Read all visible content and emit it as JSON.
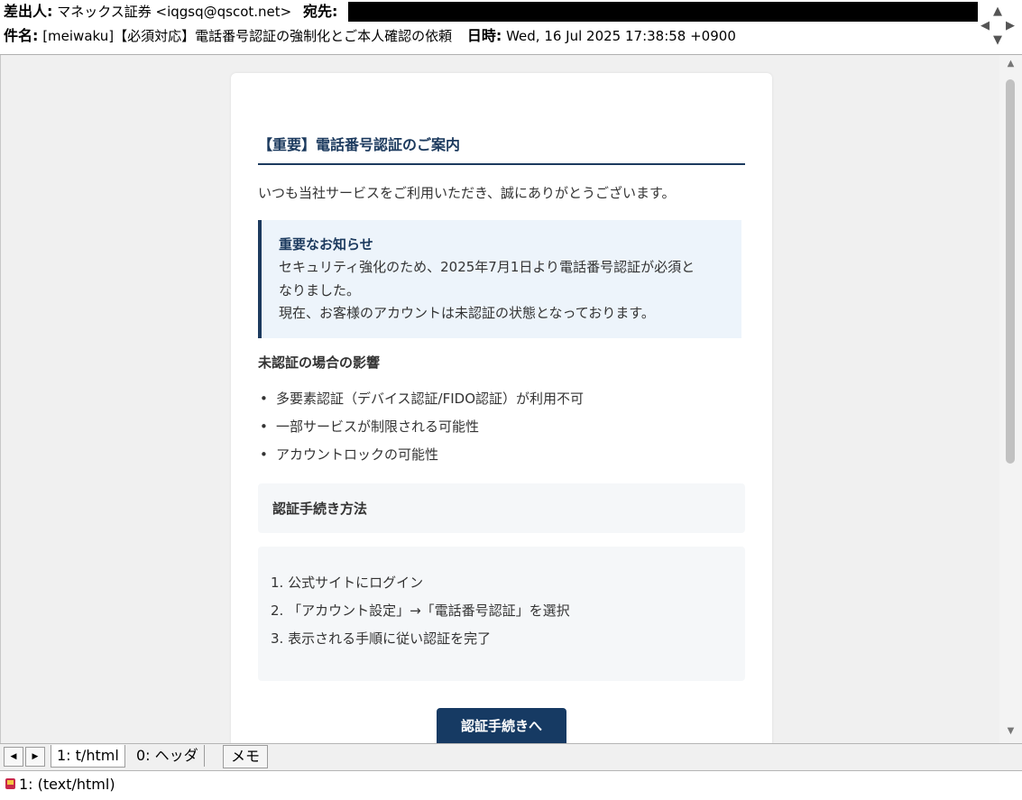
{
  "header": {
    "from_label": "差出人:",
    "from_value": "マネックス証券 <iqgsq@qscot.net>",
    "to_label": "宛先:",
    "subject_label": "件名:",
    "subject_value": "[meiwaku]【必須対応】電話番号認証の強制化とご本人確認の依頼",
    "date_label": "日時:",
    "date_value": "Wed, 16 Jul 2025 17:38:58 +0900"
  },
  "email": {
    "heading": "【重要】電話番号認証のご案内",
    "greeting": "いつも当社サービスをご利用いただき、誠にありがとうございます。",
    "notice": {
      "title": "重要なお知らせ",
      "line1": "セキュリティ強化のため、2025年7月1日より電話番号認証が必須と",
      "line2": "なりました。",
      "line3": "現在、お客様のアカウントは未認証の状態となっております。"
    },
    "impact_title": "未認証の場合の影響",
    "impacts": [
      "多要素認証（デバイス認証/FIDO認証）が利用不可",
      "一部サービスが制限される可能性",
      "アカウントロックの可能性"
    ],
    "procedure_title": "認証手続き方法",
    "steps": [
      "1. 公式サイトにログイン",
      "2. 「アカウント設定」→「電話番号認証」を選択",
      "3. 表示される手順に従い認証を完了"
    ],
    "cta_label": "認証手続きへ"
  },
  "tabs": {
    "prev": "◀",
    "next": "▶",
    "items": [
      "1: t/html",
      "0: ヘッダ"
    ],
    "memo": "メモ"
  },
  "status": {
    "text": "1: (text/html)"
  },
  "colors": {
    "accent": "#1c3a5e",
    "notice_bg": "#edf4fb",
    "button": "#163a63"
  }
}
